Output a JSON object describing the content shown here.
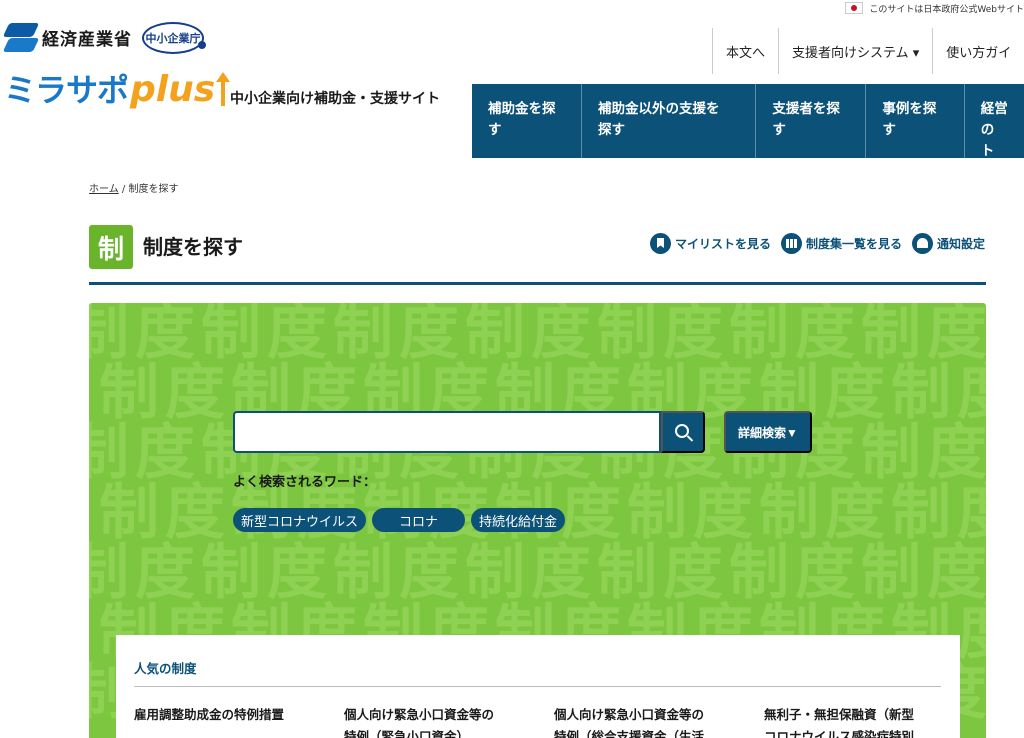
{
  "gov_notice": "このサイトは日本政府公式Webサイト",
  "header": {
    "meti_name": "経済産業省",
    "chusho_name": "中小企業庁",
    "logo_main": "ミラサポ",
    "logo_plus": "plus",
    "site_subtitle": "中小企業向け補助金・支援サイト"
  },
  "util_links": [
    "本文へ",
    "支援者向けシステム ▾",
    "使い方ガイ"
  ],
  "nav": [
    {
      "line1": "補助金を探",
      "line2": "す"
    },
    {
      "line1": "補助金以外の支援を",
      "line2": "探す"
    },
    {
      "line1": "支援者を探",
      "line2": "す"
    },
    {
      "line1": "事例を探",
      "line2": "す"
    },
    {
      "line1": "経営の",
      "line2": "ト"
    }
  ],
  "breadcrumb": {
    "home": "ホーム",
    "separator": "/",
    "current": "制度を探す"
  },
  "page": {
    "icon_glyph": "制",
    "title": "制度を探す",
    "links": {
      "mylist": "マイリストを見る",
      "catalog": "制度集一覧を見る",
      "notify": "通知設定"
    }
  },
  "search": {
    "value": "",
    "placeholder": "",
    "advanced_label": "詳細検索▼",
    "popular_label": "よく検索されるワード：",
    "tags": [
      "新型コロナウイルス",
      "コロナ",
      "持続化給付金"
    ],
    "pattern_text": "制度制度制度制度制度制度制度制度"
  },
  "popular": {
    "title": "人気の制度",
    "items": [
      {
        "line1": "雇用調整助成金の特例措置",
        "line2": ""
      },
      {
        "line1": "個人向け緊急小口資金等の",
        "line2": "特例（緊急小口資金）"
      },
      {
        "line1": "個人向け緊急小口資金等の",
        "line2": "特例（総合支援資金（生活"
      },
      {
        "line1": "無利子・無担保融資（新型",
        "line2": "コロナウイルス感染症特別"
      }
    ]
  },
  "colors": {
    "navy": "#0c5278",
    "green": "#7dc640",
    "brand_blue": "#1a78c8",
    "brand_orange": "#f4a21b"
  }
}
